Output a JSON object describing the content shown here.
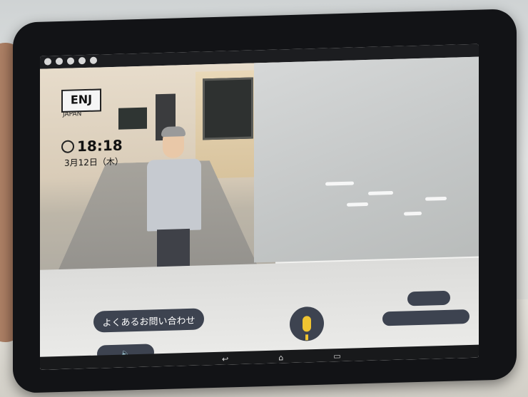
{
  "branding": {
    "logo_text": "ENJ",
    "logo_sub": "JAPAN"
  },
  "clock": {
    "time": "18:18",
    "date": "3月12日（木）"
  },
  "buttons": {
    "faq": "よくあるお問い合わせ",
    "speaker": "🔈",
    "right_top": "",
    "right_bottom": ""
  },
  "icons": {
    "clock": "clock-icon",
    "mic": "microphone-icon",
    "speaker": "speaker-icon"
  },
  "navbar": {
    "back": "↩",
    "home": "⌂",
    "recents": "▭"
  },
  "colors": {
    "button_bg": "#3d4350",
    "mic_accent": "#f0c431"
  }
}
